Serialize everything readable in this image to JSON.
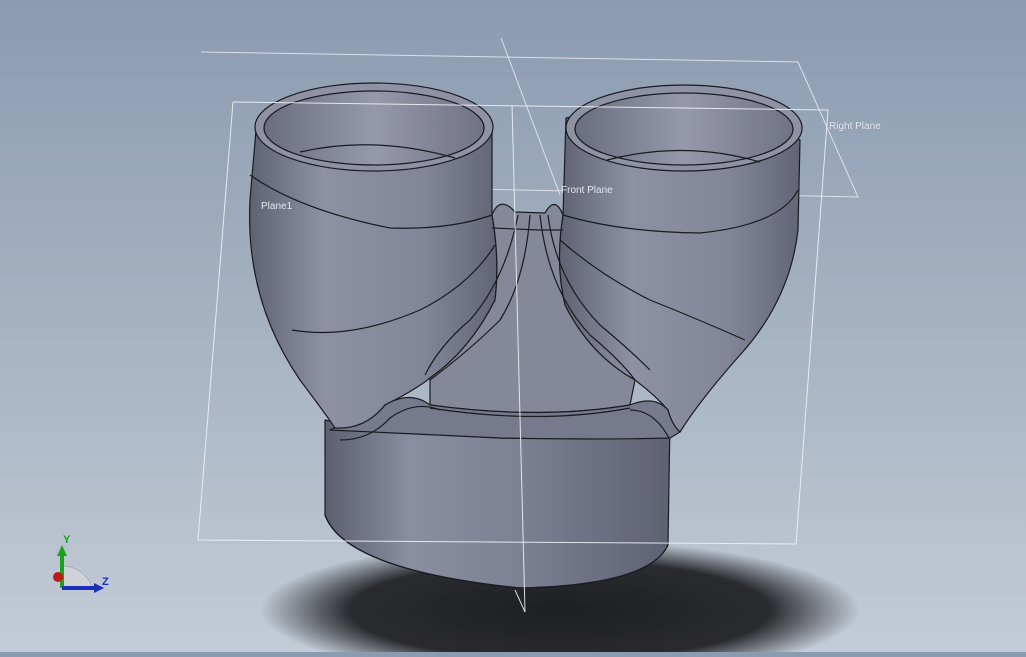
{
  "viewport": {
    "planes": {
      "right_plane": "Right Plane",
      "front_plane": "Front Plane",
      "plane1": "Plane1"
    },
    "triad": {
      "y_label": "Y",
      "z_label": "Z",
      "y_color": "#19a319",
      "z_color": "#1a2fb8",
      "x_color": "#c01818"
    },
    "part_color": "#7c7f92",
    "background_top": "#8b9bb0",
    "background_bottom": "#c3cbd6"
  }
}
